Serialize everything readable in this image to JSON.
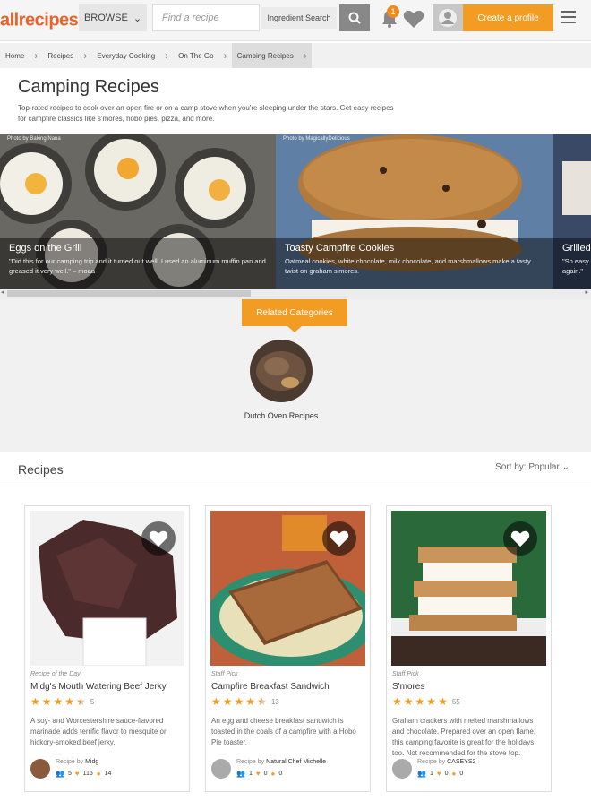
{
  "header": {
    "logo": "allrecipes",
    "browse": "BROWSE",
    "search_placeholder": "Find a recipe",
    "ingredient_search": "Ingredient Search",
    "notif_count": "1",
    "create_profile": "Create a profile"
  },
  "breadcrumb": [
    "Home",
    "Recipes",
    "Everyday Cooking",
    "On The Go",
    "Camping Recipes"
  ],
  "page": {
    "title": "Camping Recipes",
    "description": "Top-rated recipes to cook over an open fire or on a camp stove when you're sleeping under the stars. Get easy recipes for campfire classics like s'mores, hobo pies, pizza, and more."
  },
  "carousel": [
    {
      "photo": "Photo by Baking Nana",
      "title": "Eggs on the Grill",
      "desc": "\"Did this for our camping trip and it turned out well! I used an aluminum muffin pan and greased it very well.\" – moaa"
    },
    {
      "photo": "Photo by MagicallyDelicious",
      "title": "Toasty Campfire Cookies",
      "desc": "Oatmeal cookies, white chocolate, milk chocolate, and marshmallows make a tasty twist on graham s'mores."
    },
    {
      "photo": "",
      "title": "Grilled",
      "desc": "\"So easy again.\""
    }
  ],
  "related": {
    "button": "Related Categories",
    "category": "Dutch Oven Recipes"
  },
  "recipes": {
    "heading": "Recipes",
    "sort": "Sort by: Popular"
  },
  "cards": [
    {
      "label": "Recipe of the Day",
      "title": "Midg's Mouth Watering Beef Jerky",
      "rating": 4.5,
      "count": "5",
      "desc": "A soy- and Worcestershire sauce-flavored marinade adds terrific flavor to mesquite or hickory-smoked beef jerky.",
      "by_prefix": "Recipe by",
      "author": "Midg",
      "made": "5",
      "favs": "115",
      "tips": "14"
    },
    {
      "label": "Staff Pick",
      "title": "Campfire Breakfast Sandwich",
      "rating": 4.5,
      "count": "13",
      "desc": "An egg and cheese breakfast sandwich is toasted in the coals of a campfire with a Hobo Pie toaster.",
      "by_prefix": "Recipe by",
      "author": "Natural Chef Michelle",
      "made": "1",
      "favs": "0",
      "tips": "0"
    },
    {
      "label": "Staff Pick",
      "title": "S'mores",
      "rating": 5,
      "count": "55",
      "desc": "Graham crackers with melted marshmallows and chocolate. Prepared over an open flame, this camping favorite is great for the holidays, too. Not recommended for the stove top.",
      "by_prefix": "Recipe by",
      "author": "CASEYS2",
      "made": "1",
      "favs": "0",
      "tips": "0"
    }
  ]
}
